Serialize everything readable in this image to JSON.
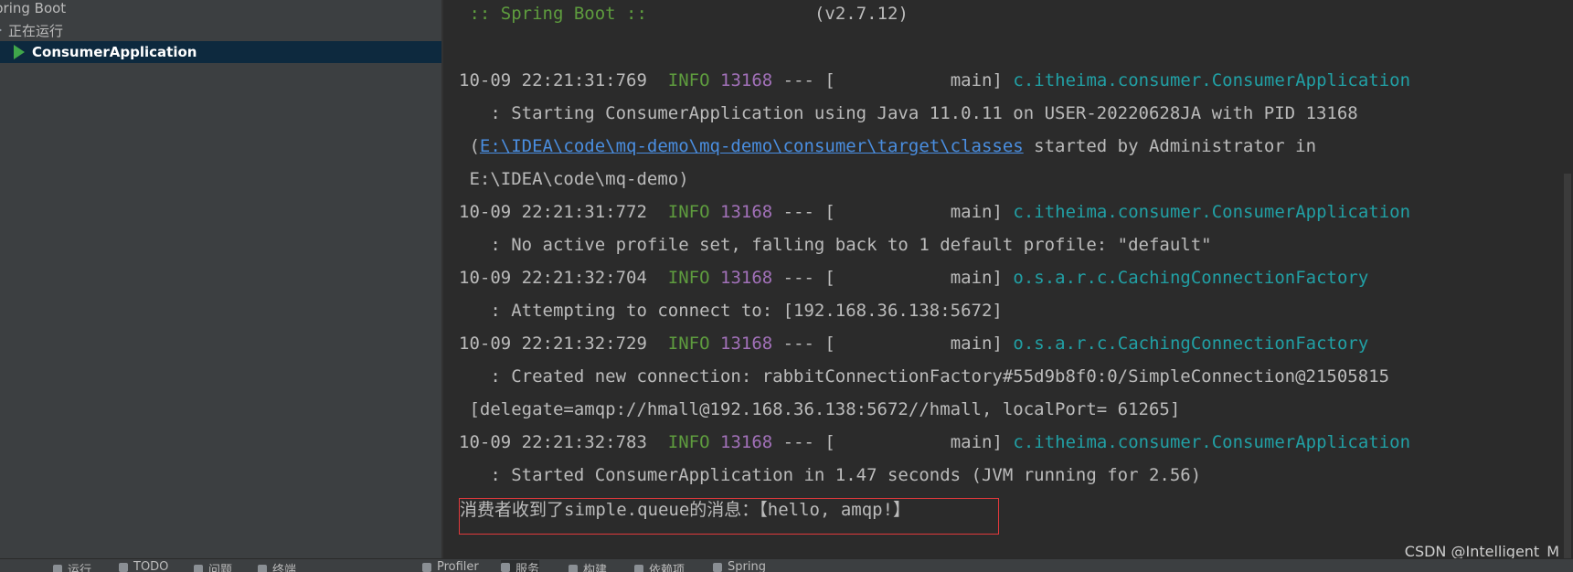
{
  "services_tree": {
    "root_label": "pring Boot",
    "running_label": "正在运行",
    "selected_app": "ConsumerApplication"
  },
  "console": {
    "banner_prefix": " :: Spring Boot :: ",
    "banner_version": "(v2.7.12)",
    "logs": [
      {
        "timestamp": "10-09 22:21:31:769",
        "level": "INFO",
        "pid": "13168",
        "sep": "--- [",
        "thread": "main]",
        "logger": "c.itheima.consumer.ConsumerApplication",
        "msg1": "   : Starting ConsumerApplication using Java 11.0.11 on USER-20220628JA with PID 13168",
        "msg2_prefix": " (",
        "msg2_link": "E:\\IDEA\\code\\mq-demo\\mq-demo\\consumer\\target\\classes",
        "msg2_suffix": " started by Administrator in",
        "msg3": " E:\\IDEA\\code\\mq-demo)"
      },
      {
        "timestamp": "10-09 22:21:31:772",
        "level": "INFO",
        "pid": "13168",
        "sep": "--- [",
        "thread": "main]",
        "logger": "c.itheima.consumer.ConsumerApplication",
        "msg1": "   : No active profile set, falling back to 1 default profile: \"default\""
      },
      {
        "timestamp": "10-09 22:21:32:704",
        "level": "INFO",
        "pid": "13168",
        "sep": "--- [",
        "thread": "main]",
        "logger": "o.s.a.r.c.CachingConnectionFactory",
        "msg1": "   : Attempting to connect to: [192.168.36.138:5672]"
      },
      {
        "timestamp": "10-09 22:21:32:729",
        "level": "INFO",
        "pid": "13168",
        "sep": "--- [",
        "thread": "main]",
        "logger": "o.s.a.r.c.CachingConnectionFactory",
        "msg1": "   : Created new connection: rabbitConnectionFactory#55d9b8f0:0/SimpleConnection@21505815",
        "msg2": " [delegate=amqp://hmall@192.168.36.138:5672//hmall, localPort= 61265]"
      },
      {
        "timestamp": "10-09 22:21:32:783",
        "level": "INFO",
        "pid": "13168",
        "sep": "--- [",
        "thread": "main]",
        "logger": "c.itheima.consumer.ConsumerApplication",
        "msg1": "   : Started ConsumerApplication in 1.47 seconds (JVM running for 2.56)"
      }
    ],
    "consumer_output": "消费者收到了simple.queue的消息：【hello, amqp!】"
  },
  "watermark": "CSDN @Intelligent_M",
  "bottom_bar": {
    "tabs": [
      "运行",
      "TODO",
      "问题",
      "终端",
      "Profiler",
      "服务",
      "构建",
      "依赖项",
      "Spring"
    ]
  },
  "colors": {
    "info_green": "#5e9c3e",
    "pid_purple": "#a271b9",
    "logger_teal": "#21a0a5",
    "link_blue": "#4a8ee0",
    "highlight_red": "#e0393c",
    "selection_bg": "#0d293e"
  }
}
